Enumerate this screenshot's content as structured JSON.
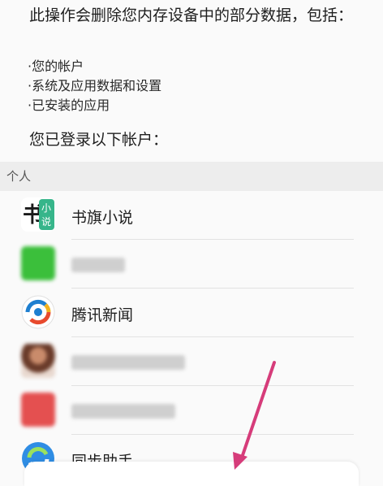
{
  "warning_text": "此操作会删除您内存设备中的部分数据，包括：",
  "bullets": [
    "·您的帐户",
    "·系统及应用数据和设置",
    "·已安装的应用"
  ],
  "accounts_heading": "您已登录以下帐户：",
  "section_label": "个人",
  "accounts": [
    {
      "name": "书旗小说",
      "icon": "shuqi-novel-icon",
      "blurred": false
    },
    {
      "name": "",
      "icon": "wechat-icon",
      "blurred": true
    },
    {
      "name": "腾讯新闻",
      "icon": "tencent-news-icon",
      "blurred": false
    },
    {
      "name": "",
      "icon": "avatar-icon",
      "blurred": true
    },
    {
      "name": "",
      "icon": "red-app-icon",
      "blurred": true
    },
    {
      "name": "同步助手",
      "icon": "sync-assistant-icon",
      "blurred": false
    }
  ],
  "icon_texts": {
    "shuqi_char": "书",
    "shuqi_badge_top": "小",
    "shuqi_badge_bottom": "说"
  },
  "colors": {
    "accent_arrow": "#d63c7a",
    "wechat_green": "#3bbf3b",
    "tencent_blue": "#1e7fd0",
    "tencent_red": "#e84a2e",
    "red_app": "#e45050",
    "shuqi_badge": "#36b58a"
  }
}
